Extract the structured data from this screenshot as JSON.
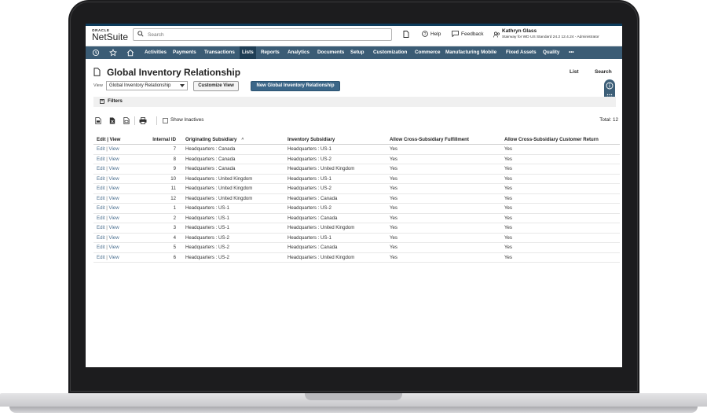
{
  "logo": {
    "oracle": "ORACLE",
    "product": "NetSuite"
  },
  "search": {
    "placeholder": "Search"
  },
  "header": {
    "help": "Help",
    "feedback": "Feedback",
    "user_name": "Kathryn Glass",
    "user_role": "Stairway for WD US Standard 24.2 12.4.24 - Administrator"
  },
  "nav": {
    "items": [
      "Activities",
      "Payments",
      "Transactions",
      "Lists",
      "Reports",
      "Analytics",
      "Documents",
      "Setup",
      "Customization",
      "Commerce",
      "Manufacturing Mobile",
      "Fixed Assets",
      "Quality"
    ],
    "active": "Lists",
    "more": "•••"
  },
  "page": {
    "title": "Global Inventory Relationship",
    "list_link": "List",
    "search_link": "Search"
  },
  "view": {
    "label": "View",
    "selected": "Global Inventory Relationship",
    "customize_button": "Customize View",
    "new_button": "New Global Inventory Relationship"
  },
  "filters": {
    "toggle": "+",
    "label": "Filters"
  },
  "toolbar": {
    "show_inactives": "Show Inactives",
    "total": "Total: 12"
  },
  "table": {
    "columns": [
      "Edit | View",
      "Internal ID",
      "Originating Subsidiary",
      "Inventory Subsidiary",
      "Allow Cross-Subsidiary Fulfillment",
      "Allow Cross-Subsidiary Customer Return"
    ],
    "sort_indicator": "^",
    "edit_label": "Edit",
    "view_label": "View",
    "rows": [
      {
        "id": "7",
        "orig": "Headquarters : Canada",
        "inv": "Headquarters : US-1",
        "fulfill": "Yes",
        "ret": "Yes"
      },
      {
        "id": "8",
        "orig": "Headquarters : Canada",
        "inv": "Headquarters : US-2",
        "fulfill": "Yes",
        "ret": "Yes"
      },
      {
        "id": "9",
        "orig": "Headquarters : Canada",
        "inv": "Headquarters : United Kingdom",
        "fulfill": "Yes",
        "ret": "Yes"
      },
      {
        "id": "10",
        "orig": "Headquarters : United Kingdom",
        "inv": "Headquarters : US-1",
        "fulfill": "Yes",
        "ret": "Yes"
      },
      {
        "id": "11",
        "orig": "Headquarters : United Kingdom",
        "inv": "Headquarters : US-2",
        "fulfill": "Yes",
        "ret": "Yes"
      },
      {
        "id": "12",
        "orig": "Headquarters : United Kingdom",
        "inv": "Headquarters : Canada",
        "fulfill": "Yes",
        "ret": "Yes"
      },
      {
        "id": "1",
        "orig": "Headquarters : US-1",
        "inv": "Headquarters : US-2",
        "fulfill": "Yes",
        "ret": "Yes"
      },
      {
        "id": "2",
        "orig": "Headquarters : US-1",
        "inv": "Headquarters : Canada",
        "fulfill": "Yes",
        "ret": "Yes"
      },
      {
        "id": "3",
        "orig": "Headquarters : US-1",
        "inv": "Headquarters : United Kingdom",
        "fulfill": "Yes",
        "ret": "Yes"
      },
      {
        "id": "4",
        "orig": "Headquarters : US-2",
        "inv": "Headquarters : US-1",
        "fulfill": "Yes",
        "ret": "Yes"
      },
      {
        "id": "5",
        "orig": "Headquarters : US-2",
        "inv": "Headquarters : Canada",
        "fulfill": "Yes",
        "ret": "Yes"
      },
      {
        "id": "6",
        "orig": "Headquarters : US-2",
        "inv": "Headquarters : United Kingdom",
        "fulfill": "Yes",
        "ret": "Yes"
      }
    ]
  },
  "colors": {
    "nav_bg": "#3b5c75",
    "nav_active": "#1f3e55",
    "primary_button": "#3b6688",
    "link": "#4b6f8f",
    "laptop_frame": "#1c1c1e"
  }
}
